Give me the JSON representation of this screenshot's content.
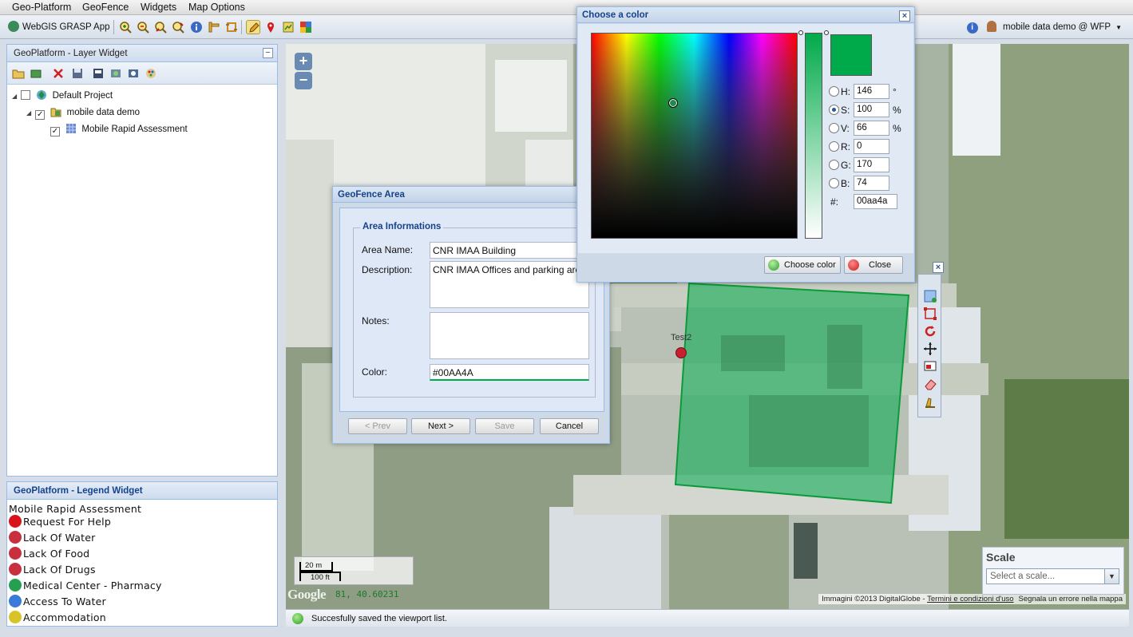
{
  "menu": [
    "Geo-Platform",
    "GeoFence",
    "Widgets",
    "Map Options"
  ],
  "toolbar": {
    "app_name": "WebGIS GRASP App",
    "tools": [
      "zoom-in-icon",
      "zoom-out-icon",
      "zoom-previous-icon",
      "zoom-next-icon",
      "info-icon",
      "measure-icon",
      "measure-area-icon",
      "edit-icon",
      "marker-icon",
      "print-icon",
      "google-icon"
    ],
    "user": "mobile data demo @ WFP"
  },
  "layer_widget": {
    "title": "GeoPlatform - Layer Widget",
    "tree": [
      {
        "label": "Default Project",
        "checked": false,
        "level": 0
      },
      {
        "label": "mobile data demo",
        "checked": true,
        "level": 1
      },
      {
        "label": "Mobile Rapid Assessment",
        "checked": true,
        "level": 2
      }
    ]
  },
  "legend_widget": {
    "title": "GeoPlatform - Legend Widget",
    "layer": "Mobile Rapid Assessment",
    "items": [
      {
        "label": "Request For Help",
        "color": "#d8141a"
      },
      {
        "label": "Lack Of Water",
        "color": "#c83040"
      },
      {
        "label": "Lack Of Food",
        "color": "#c83040"
      },
      {
        "label": "Lack Of Drugs",
        "color": "#c83040"
      },
      {
        "label": "Medical Center - Pharmacy",
        "color": "#24a050"
      },
      {
        "label": "Access To Water",
        "color": "#3a7ad8"
      },
      {
        "label": "Accommodation",
        "color": "#d8c428"
      }
    ]
  },
  "map": {
    "zoom_in": "+",
    "zoom_out": "−",
    "scale_m": "20 m",
    "scale_ft": "100 ft",
    "mouse_position": "81, 40.60231",
    "google": "Google",
    "copyright_text": "Immagini ©2013 DigitalGlobe - ",
    "copyright_link": "Termini e condizioni d'uso",
    "report_error": "Segnala un errore nella mappa",
    "marker_label": "Test2",
    "polygon_color": "#00aa4a"
  },
  "scale_box": {
    "title": "Scale",
    "placeholder": "Select a scale..."
  },
  "status": {
    "message": "Succesfully saved the viewport list."
  },
  "geofence": {
    "title": "GeoFence Area",
    "section": "Area Informations",
    "area_name_label": "Area Name:",
    "area_name": "CNR IMAA Building",
    "description_label": "Description:",
    "description": "CNR IMAA Offices and parking area",
    "notes_label": "Notes:",
    "notes": "",
    "color_label": "Color:",
    "color": "#00AA4A",
    "buttons": {
      "prev": "< Prev",
      "next": "Next >",
      "save": "Save",
      "cancel": "Cancel"
    }
  },
  "color_picker": {
    "title": "Choose a color",
    "h_label": "H:",
    "h": "146",
    "h_unit": "°",
    "s_label": "S:",
    "s": "100",
    "s_unit": "%",
    "v_label": "V:",
    "v": "66",
    "v_unit": "%",
    "r_label": "R:",
    "r": "0",
    "g_label": "G:",
    "g": "170",
    "b_label": "B:",
    "b": "74",
    "hex_label": "#:",
    "hex": "00aa4a",
    "selected_mode": "S",
    "choose_button": "Choose color",
    "close_button": "Close",
    "swatch_color": "#00aa4a"
  }
}
